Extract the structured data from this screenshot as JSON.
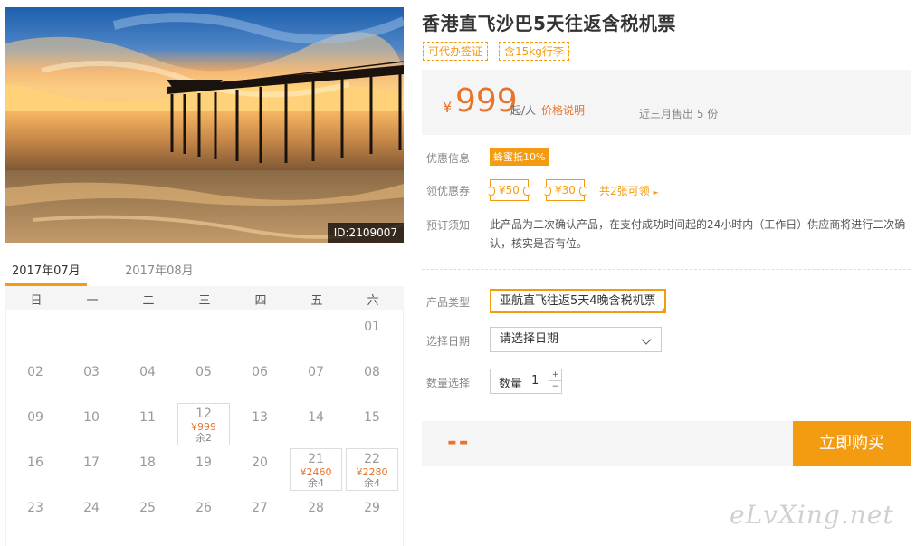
{
  "hero": {
    "id_label": "ID:2109007"
  },
  "calendar": {
    "tabs": [
      "2017年07月",
      "2017年08月"
    ],
    "weekdays": [
      "日",
      "一",
      "二",
      "三",
      "四",
      "五",
      "六"
    ],
    "days": [
      {
        "d": "01"
      },
      {
        "d": "02"
      },
      {
        "d": "03"
      },
      {
        "d": "04"
      },
      {
        "d": "05"
      },
      {
        "d": "06"
      },
      {
        "d": "07"
      },
      {
        "d": "08"
      },
      {
        "d": "09"
      },
      {
        "d": "10"
      },
      {
        "d": "11"
      },
      {
        "d": "12",
        "price": "¥999",
        "remain": "余2"
      },
      {
        "d": "13"
      },
      {
        "d": "14"
      },
      {
        "d": "15"
      },
      {
        "d": "16"
      },
      {
        "d": "17"
      },
      {
        "d": "18"
      },
      {
        "d": "19"
      },
      {
        "d": "20"
      },
      {
        "d": "21",
        "price": "¥2460",
        "remain": "余4"
      },
      {
        "d": "22",
        "price": "¥2280",
        "remain": "余4"
      },
      {
        "d": "23"
      },
      {
        "d": "24"
      },
      {
        "d": "25"
      },
      {
        "d": "26"
      },
      {
        "d": "27"
      },
      {
        "d": "28"
      },
      {
        "d": "29"
      }
    ]
  },
  "product": {
    "title": "香港直飞沙巴5天往返含税机票",
    "tags": [
      "可代办签证",
      "含15kg行李"
    ],
    "price": {
      "currency": "¥",
      "amount": "999",
      "unit": "起/人",
      "explain_link": "价格说明",
      "sold_text": "近三月售出 5 份"
    },
    "promo": {
      "label": "优惠信息",
      "badge": "蜂蜜抵10%"
    },
    "coupons": {
      "label": "领优惠券",
      "items": [
        "¥50",
        "¥30"
      ],
      "link": "共2张可领"
    },
    "notice": {
      "label": "预订须知",
      "text": "此产品为二次确认产品，在支付成功时间起的24小时内（工作日）供应商将进行二次确认，核实是否有位。"
    }
  },
  "options": {
    "type_label": "产品类型",
    "type_value": "亚航直飞往返5天4晚含税机票",
    "date_label": "选择日期",
    "date_value": "请选择日期",
    "qty_label": "数量选择",
    "qty_inner_label": "数量",
    "qty_value": "1",
    "qty_up": "+",
    "qty_down": "−"
  },
  "purchase": {
    "total": "--",
    "buy_label": "立即购买"
  },
  "watermark": "eLvXing.net",
  "colors": {
    "accent": "#f39c12",
    "price": "#e8742c"
  }
}
